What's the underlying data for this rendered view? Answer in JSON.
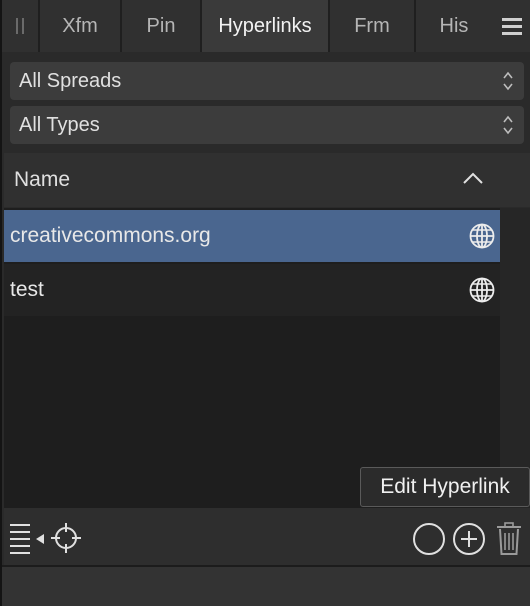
{
  "tabs": [
    {
      "label": "Xfm",
      "active": false
    },
    {
      "label": "Pin",
      "active": false
    },
    {
      "label": "Hyperlinks",
      "active": true
    },
    {
      "label": "Frm",
      "active": false
    },
    {
      "label": "His",
      "active": false
    }
  ],
  "filters": {
    "spreads": "All Spreads",
    "types": "All Types"
  },
  "list": {
    "column_header": "Name",
    "sort": "ascending",
    "rows": [
      {
        "name": "creativecommons.org",
        "icon": "globe-icon",
        "selected": true
      },
      {
        "name": "test",
        "icon": "globe-icon",
        "selected": false
      }
    ]
  },
  "tooltip": "Edit Hyperlink",
  "toolbar": {
    "icons": [
      "list-options-icon",
      "target-icon",
      "circle-icon",
      "add-icon",
      "trash-icon"
    ]
  },
  "colors": {
    "selection": "#4a668f",
    "panel": "#2a2a2a"
  }
}
